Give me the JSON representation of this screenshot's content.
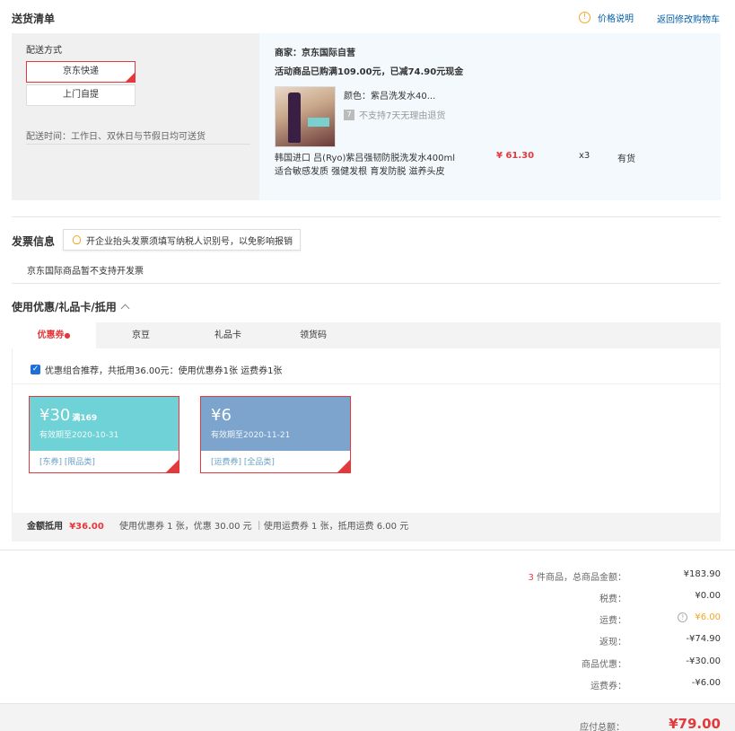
{
  "shipping": {
    "title": "送货清单",
    "price_note": "价格说明",
    "back_to_cart": "返回修改购物车",
    "method_label": "配送方式",
    "options": [
      "京东快递",
      "上门自提"
    ],
    "delivery_time": "配送时间：工作日、双休日与节假日均可送货",
    "merchant": "商家：京东国际自营",
    "promo": "活动商品已购满109.00元，已减74.90元现金",
    "product": {
      "color": "颜色：紫吕洗发水40...",
      "return_policy": "不支持7天无理由退货",
      "name_line1": "韩国进口 吕(Ryo)紫吕强韧防脱洗发水400ml",
      "name_line2": "适合敏感发质 强健发根 育发防脱 滋养头皮",
      "price": "¥ 61.30",
      "qty": "x3",
      "stock": "有货"
    }
  },
  "invoice": {
    "title": "发票信息",
    "tip": "开企业抬头发票须填写纳税人识别号，以免影响报销",
    "note": "京东国际商品暂不支持开发票"
  },
  "discount": {
    "title": "使用优惠/礼品卡/抵用",
    "tabs": [
      "优惠券",
      "京豆",
      "礼品卡",
      "领货码"
    ],
    "recommend": "优惠组合推荐，共抵用36.00元：使用优惠券1张 运费券1张",
    "coupons": [
      {
        "amount": "¥30",
        "condition": "满169",
        "expiry": "有效期至2020-10-31",
        "tags": "[东券]  [限品类]",
        "color": "#6fd2d6"
      },
      {
        "amount": "¥6",
        "condition": "",
        "expiry": "有效期至2020-11-21",
        "tags": "[运费券]  [全品类]",
        "color": "#7ca4cc"
      }
    ],
    "summary_label": "金额抵用",
    "summary_amount": "¥36.00",
    "summary_detail": "使用优惠券 1 张，优惠 30.00 元 ｜使用运费券 1 张，抵用运费 6.00 元"
  },
  "totals": {
    "item_count": "3",
    "items_label": "件商品，总商品金额：",
    "items_value": "¥183.90",
    "tax_label": "税费：",
    "tax_value": "¥0.00",
    "shipping_label": "运费：",
    "shipping_value": "¥6.00",
    "cashback_label": "返现：",
    "cashback_value": "-¥74.90",
    "coupon_label": "商品优惠：",
    "coupon_value": "-¥30.00",
    "ship_coupon_label": "运费券：",
    "ship_coupon_value": "-¥6.00",
    "grand_label": "应付总额：",
    "grand_value": "¥79.00"
  },
  "colors": {
    "accent": "#e4393c",
    "link": "#005ea7",
    "warning": "#f5a623"
  }
}
